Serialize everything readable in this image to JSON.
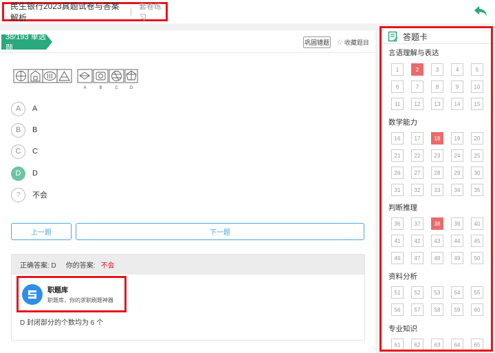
{
  "header": {
    "title": "民生银行2023真题试卷与答案解析",
    "separator": "|",
    "mode": "套卷练习",
    "back_icon": "back-arrow-icon",
    "accent_color": "#2aa87e"
  },
  "question": {
    "tag": "38/193 单选题",
    "consolidate_label": "巩固错题",
    "favorite_label": "收藏题目",
    "figure_labels": [
      "A",
      "B",
      "C",
      "D"
    ],
    "options": [
      {
        "letter": "A",
        "text": "A"
      },
      {
        "letter": "B",
        "text": "B"
      },
      {
        "letter": "C",
        "text": "C"
      },
      {
        "letter": "D",
        "text": "D"
      },
      {
        "letter": "?",
        "text": "不会"
      }
    ],
    "selected": "D"
  },
  "navigation": {
    "prev_label": "上一题",
    "next_label": "下一题"
  },
  "analysis": {
    "correct_label": "正确答案: D",
    "your_answer_label": "你的答案:",
    "your_answer_value": "不会",
    "app_name": "职题库",
    "app_desc": "职题库，你的求职刷题神器",
    "explanation": "D 封闭部分的个数均为 6 个"
  },
  "answer_card": {
    "title": "答题卡",
    "wrong_color": "#eb6a6a",
    "sections": [
      {
        "name": "言语理解与表达",
        "numbers": [
          "1",
          "2",
          "3",
          "4",
          "5",
          "6",
          "7",
          "8",
          "9",
          "10",
          "11",
          "12",
          "13",
          "14",
          "15"
        ],
        "wrong": [
          "2"
        ]
      },
      {
        "name": "数学能力",
        "numbers": [
          "16",
          "17",
          "18",
          "19",
          "20",
          "21",
          "22",
          "23",
          "24",
          "25",
          "26",
          "27",
          "28",
          "29",
          "30",
          "31",
          "32",
          "33",
          "34",
          "35"
        ],
        "wrong": [
          "18"
        ]
      },
      {
        "name": "判断推理",
        "numbers": [
          "36",
          "37",
          "38",
          "39",
          "40",
          "41",
          "42",
          "43",
          "44",
          "45",
          "46",
          "47",
          "48",
          "49",
          "50"
        ],
        "wrong": [
          "38"
        ]
      },
      {
        "name": "资料分析",
        "numbers": [
          "51",
          "52",
          "53",
          "54",
          "55",
          "56",
          "57",
          "58",
          "59",
          "60"
        ],
        "wrong": []
      },
      {
        "name": "专业知识",
        "numbers": [
          "61",
          "62",
          "63",
          "64",
          "65"
        ],
        "wrong": []
      }
    ]
  }
}
